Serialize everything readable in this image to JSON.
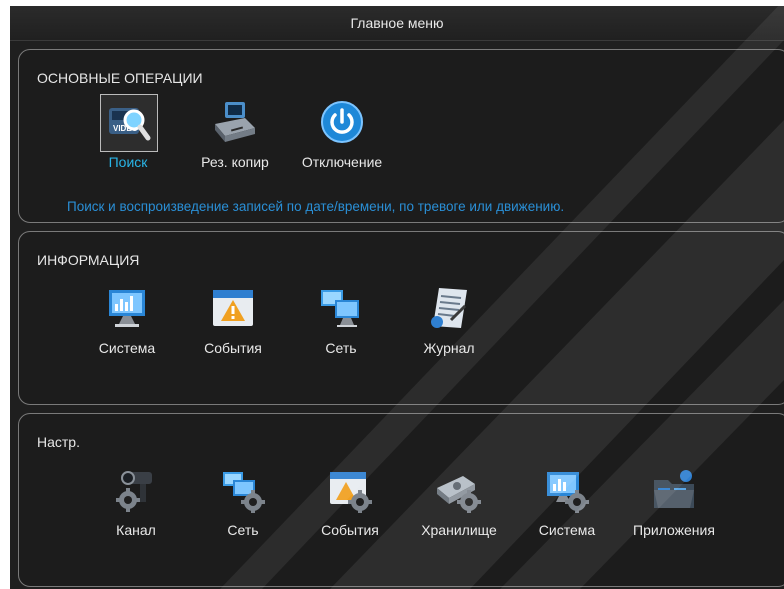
{
  "window": {
    "title": "Главное меню"
  },
  "sections": {
    "basic": {
      "title": "ОСНОВНЫЕ ОПЕРАЦИИ",
      "items": [
        {
          "label": "Поиск",
          "icon": "video-search-icon",
          "selected": true
        },
        {
          "label": "Рез. копир",
          "icon": "backup-drive-icon"
        },
        {
          "label": "Отключение",
          "icon": "power-icon"
        }
      ],
      "description": "Поиск и воспроизведение записей по дате/времени, по тревоге или движению."
    },
    "info": {
      "title": "ИНФОРМАЦИЯ",
      "items": [
        {
          "label": "Система",
          "icon": "system-monitor-icon"
        },
        {
          "label": "События",
          "icon": "events-warning-icon"
        },
        {
          "label": "Сеть",
          "icon": "network-monitors-icon"
        },
        {
          "label": "Журнал",
          "icon": "log-document-icon"
        }
      ]
    },
    "settings": {
      "title": "Настр.",
      "items": [
        {
          "label": "Канал",
          "icon": "camera-gear-icon"
        },
        {
          "label": "Сеть",
          "icon": "network-gear-icon"
        },
        {
          "label": "События",
          "icon": "events-gear-icon"
        },
        {
          "label": "Хранилище",
          "icon": "storage-gear-icon"
        },
        {
          "label": "Система",
          "icon": "system-gear-icon"
        },
        {
          "label": "Приложения",
          "icon": "applications-folder-icon"
        }
      ]
    }
  },
  "colors": {
    "accent": "#29b4e6",
    "description": "#2a8fd6",
    "background": "#1f1f1f",
    "border": "#7a7a7a"
  }
}
